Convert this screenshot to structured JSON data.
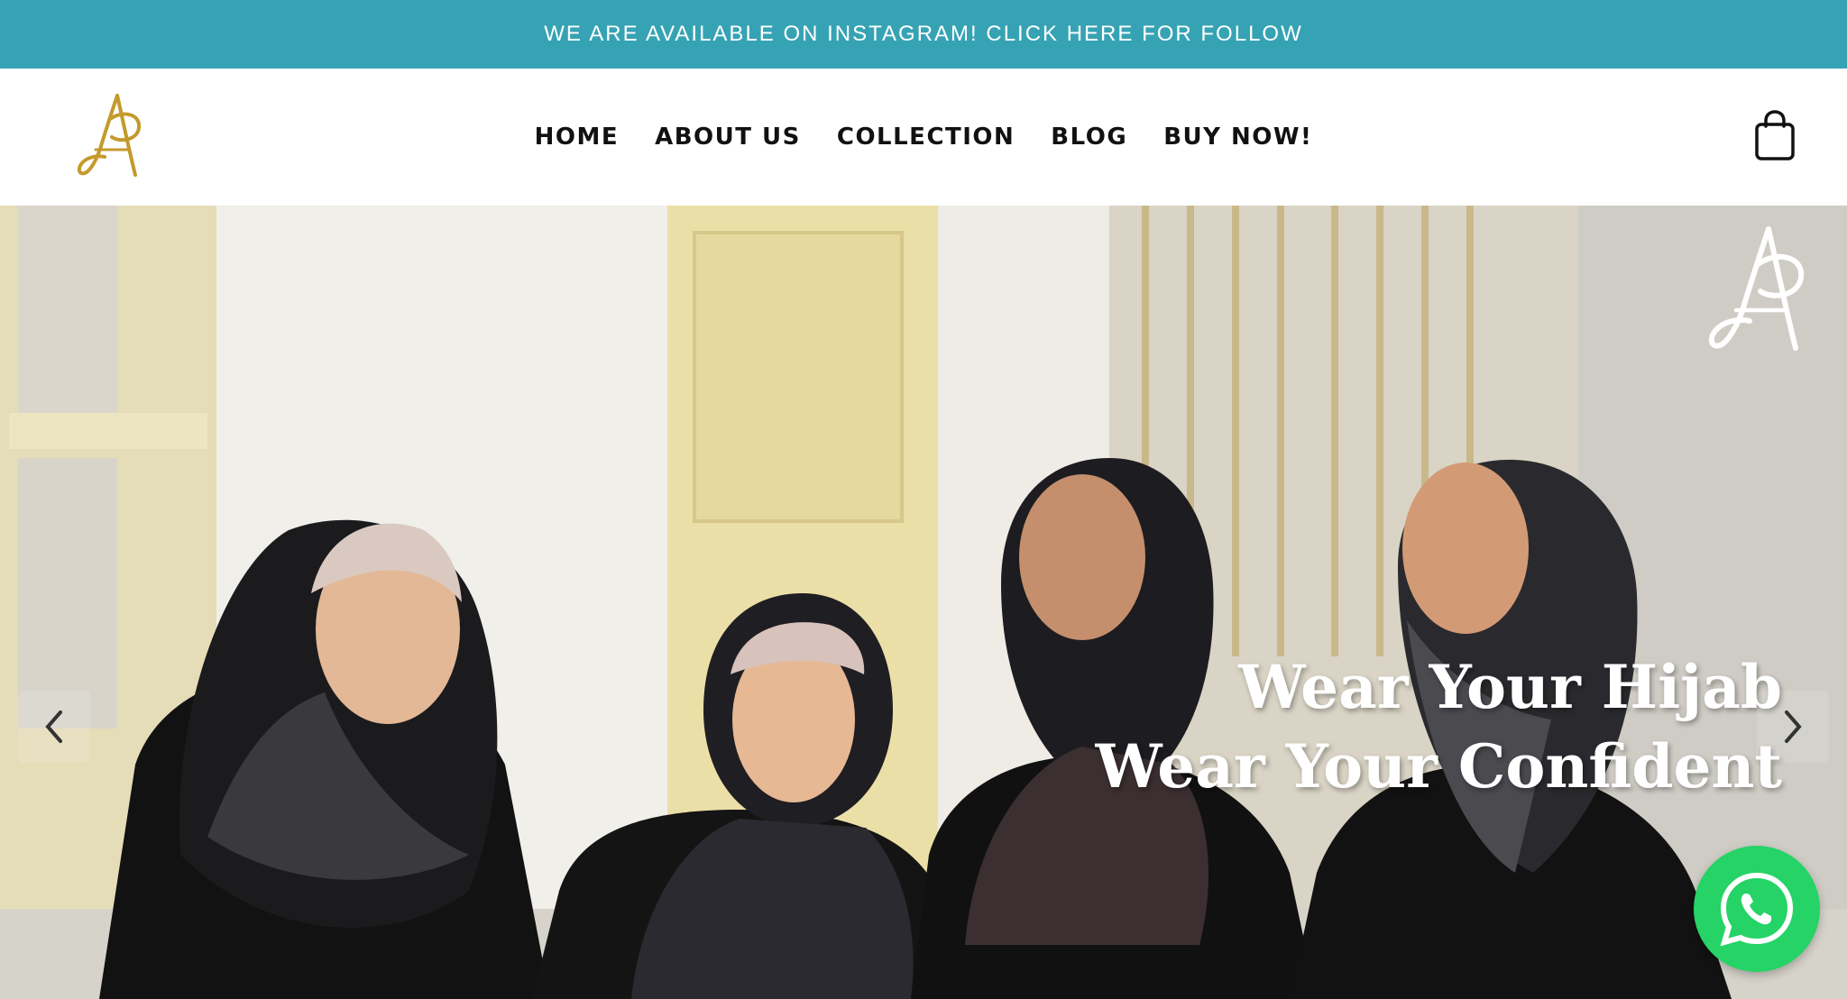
{
  "announcement": {
    "text": "WE ARE AVAILABLE ON INSTAGRAM! CLICK HERE FOR FOLLOW"
  },
  "nav": {
    "items": [
      {
        "label": "HOME"
      },
      {
        "label": "ABOUT US"
      },
      {
        "label": "COLLECTION"
      },
      {
        "label": "BLOG"
      },
      {
        "label": "BUY NOW!"
      }
    ]
  },
  "hero": {
    "headline_line1": "Wear Your Hijab",
    "headline_line2": "Wear Your Confident"
  },
  "icons": {
    "logo": "brand-logo-icon",
    "cart": "shopping-bag-icon",
    "prev": "chevron-left-icon",
    "next": "chevron-right-icon",
    "chat": "whatsapp-icon"
  },
  "colors": {
    "announce_bg": "#36a3b4",
    "logo_gold": "#c49a2c",
    "whatsapp": "#25d366"
  }
}
